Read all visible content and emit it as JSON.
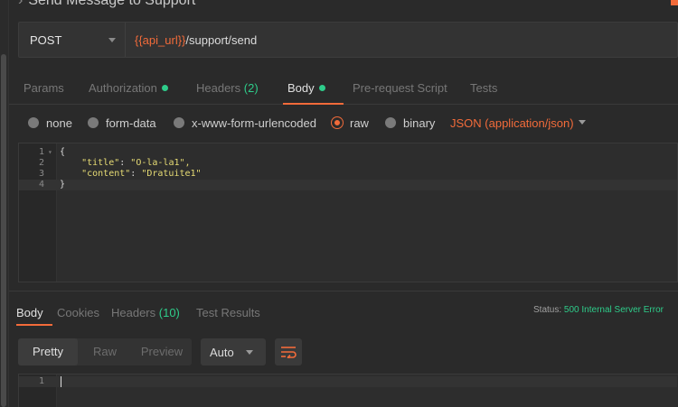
{
  "request": {
    "title": "Send Message to Support",
    "method": "POST",
    "url_var": "{{api_url}}",
    "url_path": "/support/send"
  },
  "request_tabs": [
    {
      "label": "Params"
    },
    {
      "label": "Authorization"
    },
    {
      "label": "Headers",
      "count": "(2)"
    },
    {
      "label": "Body"
    },
    {
      "label": "Pre-request Script"
    },
    {
      "label": "Tests"
    }
  ],
  "body_types": {
    "options": [
      "none",
      "form-data",
      "x-www-form-urlencoded",
      "raw",
      "binary"
    ],
    "selected": "raw",
    "language": "JSON (application/json)"
  },
  "editor": {
    "lines": [
      {
        "num": "1",
        "text": "{"
      },
      {
        "num": "2",
        "key": "\"title\"",
        "value": "\"O-la-la1\","
      },
      {
        "num": "3",
        "key": "\"content\"",
        "value": "\"Dratuite1\""
      },
      {
        "num": "4",
        "text": "}"
      }
    ]
  },
  "response": {
    "tabs": [
      {
        "label": "Body"
      },
      {
        "label": "Cookies"
      },
      {
        "label": "Headers",
        "count": "(10)"
      },
      {
        "label": "Test Results"
      }
    ],
    "status_label": "Status:",
    "status_value": "500 Internal Server Error",
    "view_modes": [
      "Pretty",
      "Raw",
      "Preview"
    ],
    "format": "Auto",
    "line_number": "1"
  },
  "colors": {
    "accent": "#f26b3a",
    "success": "#2ecc8a",
    "background": "#2a2a2a"
  }
}
